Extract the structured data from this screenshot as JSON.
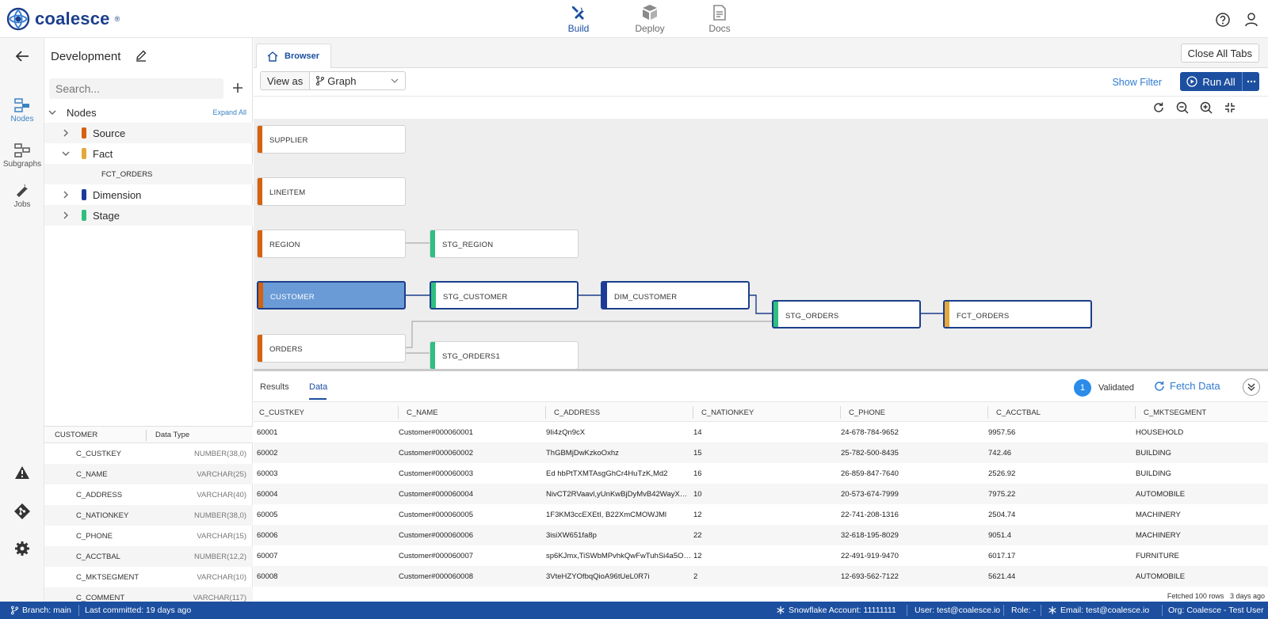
{
  "app": {
    "name": "coalesce"
  },
  "topnav": [
    {
      "label": "Build",
      "icon": "wrench-screwdriver-icon",
      "active": true
    },
    {
      "label": "Deploy",
      "icon": "deploy-icon",
      "active": false
    },
    {
      "label": "Docs",
      "icon": "docs-icon",
      "active": false
    }
  ],
  "rail": [
    {
      "label": "Nodes",
      "icon": "nodes-icon",
      "active": true
    },
    {
      "label": "Subgraphs",
      "icon": "subgraphs-icon",
      "active": false
    },
    {
      "label": "Jobs",
      "icon": "wrench-icon",
      "active": false
    }
  ],
  "workspace": {
    "title": "Development"
  },
  "search": {
    "placeholder": "Search..."
  },
  "tree": {
    "root": "Nodes",
    "expand_all": "Expand All",
    "groups": [
      {
        "label": "Source",
        "color": "#d4620f",
        "expanded": false
      },
      {
        "label": "Fact",
        "color": "#e5a83a",
        "expanded": true,
        "children": [
          "FCT_ORDERS"
        ]
      },
      {
        "label": "Dimension",
        "color": "#1c3a9c",
        "expanded": false
      },
      {
        "label": "Stage",
        "color": "#2fbf7f",
        "expanded": false
      }
    ]
  },
  "columns_panel": {
    "node_header": "CUSTOMER",
    "type_header": "Data Type",
    "rows": [
      {
        "name": "C_CUSTKEY",
        "type": "NUMBER(38,0)"
      },
      {
        "name": "C_NAME",
        "type": "VARCHAR(25)"
      },
      {
        "name": "C_ADDRESS",
        "type": "VARCHAR(40)"
      },
      {
        "name": "C_NATIONKEY",
        "type": "NUMBER(38,0)"
      },
      {
        "name": "C_PHONE",
        "type": "VARCHAR(15)"
      },
      {
        "name": "C_ACCTBAL",
        "type": "NUMBER(12,2)"
      },
      {
        "name": "C_MKTSEGMENT",
        "type": "VARCHAR(10)"
      },
      {
        "name": "C_COMMENT",
        "type": "VARCHAR(117)"
      }
    ]
  },
  "tabs": {
    "browser": "Browser",
    "close_all": "Close All Tabs"
  },
  "toolbar": {
    "view_as": "View as",
    "view_mode": "Graph",
    "show_filter": "Show Filter",
    "run_all": "Run All"
  },
  "graph": {
    "nodes": [
      {
        "id": "SUPPLIER",
        "label": "SUPPLIER",
        "color": "#d4620f"
      },
      {
        "id": "LINEITEM",
        "label": "LINEITEM",
        "color": "#d4620f"
      },
      {
        "id": "REGION",
        "label": "REGION",
        "color": "#d4620f"
      },
      {
        "id": "CUSTOMER",
        "label": "CUSTOMER",
        "color": "#d4620f"
      },
      {
        "id": "ORDERS",
        "label": "ORDERS",
        "color": "#d4620f"
      },
      {
        "id": "STG_REGION",
        "label": "STG_REGION",
        "color": "#2fbf7f"
      },
      {
        "id": "STG_CUSTOMER",
        "label": "STG_CUSTOMER",
        "color": "#2fbf7f"
      },
      {
        "id": "STG_ORDERS1",
        "label": "STG_ORDERS1",
        "color": "#2fbf7f"
      },
      {
        "id": "DIM_CUSTOMER",
        "label": "DIM_CUSTOMER",
        "color": "#1c3a9c"
      },
      {
        "id": "STG_ORDERS",
        "label": "STG_ORDERS",
        "color": "#2fbf7f"
      },
      {
        "id": "FCT_ORDERS",
        "label": "FCT_ORDERS",
        "color": "#e5a83a"
      }
    ]
  },
  "results": {
    "tabs": [
      "Results",
      "Data"
    ],
    "active_tab": "Data",
    "validated_count": "1",
    "validated_label": "Validated",
    "fetch_label": "Fetch Data",
    "columns": [
      "C_CUSTKEY",
      "C_NAME",
      "C_ADDRESS",
      "C_NATIONKEY",
      "C_PHONE",
      "C_ACCTBAL",
      "C_MKTSEGMENT"
    ],
    "rows": [
      [
        "60001",
        "Customer#000060001",
        "9Ii4zQn9cX",
        "14",
        "24-678-784-9652",
        "9957.56",
        "HOUSEHOLD"
      ],
      [
        "60002",
        "Customer#000060002",
        "ThGBMjDwKzkoOxhz",
        "15",
        "25-782-500-8435",
        "742.46",
        "BUILDING"
      ],
      [
        "60003",
        "Customer#000060003",
        "Ed hbPtTXMTAsgGhCr4HuTzK,Md2",
        "16",
        "26-859-847-7640",
        "2526.92",
        "BUILDING"
      ],
      [
        "60004",
        "Customer#000060004",
        "NivCT2RVaavl,yUnKwBjDyMvB42WayXCnky",
        "10",
        "20-573-674-7999",
        "7975.22",
        "AUTOMOBILE"
      ],
      [
        "60005",
        "Customer#000060005",
        "1F3KM3ccEXEtI, B22XmCMOWJMl",
        "12",
        "22-741-208-1316",
        "2504.74",
        "MACHINERY"
      ],
      [
        "60006",
        "Customer#000060006",
        "3isiXW651fa8p",
        "22",
        "32-618-195-8029",
        "9051.4",
        "MACHINERY"
      ],
      [
        "60007",
        "Customer#000060007",
        "sp6KJmx,TiSWbMPvhkQwFwTuhSi4a5OTfmVcan",
        "12",
        "22-491-919-9470",
        "6017.17",
        "FURNITURE"
      ],
      [
        "60008",
        "Customer#000060008",
        "3VteHZYOfbqQioA96tUeL0R7i",
        "2",
        "12-693-562-7122",
        "5621.44",
        "AUTOMOBILE"
      ]
    ],
    "fetched": "Fetched 100 rows",
    "fetched_ago": "3 days ago"
  },
  "status": {
    "branch": "Branch: main",
    "last_commit": "Last committed: 19 days ago",
    "snowflake": "Snowflake Account: 11111111",
    "user": "User: test@coalesce.io",
    "role": "Role: -",
    "email": "Email: test@coalesce.io",
    "org": "Org: Coalesce - Test User"
  }
}
